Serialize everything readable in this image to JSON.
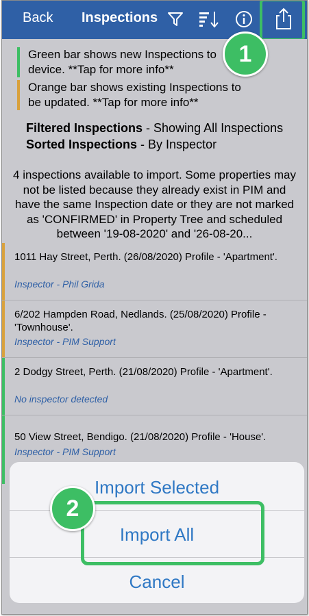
{
  "nav": {
    "back_label": "Back",
    "title": "Inspections",
    "icons": [
      "filter-icon",
      "sort-icon",
      "info-icon",
      "share-icon"
    ]
  },
  "legend": {
    "green_line1": "Green bar shows new Inspections to",
    "green_line2": "device. **Tap for more info**",
    "orange_line1": "Orange bar shows existing Inspections to",
    "orange_line2": "be updated. **Tap for more info**"
  },
  "status": {
    "filtered_label": "Filtered Inspections",
    "filtered_value": " - Showing All Inspections",
    "sorted_label": "Sorted Inspections",
    "sorted_value": " - By Inspector"
  },
  "notice": "4 inspections available to import. Some properties may not be listed because they already exist in PIM and have the same Inspection date or they are not marked as 'CONFIRMED' in Property Tree and scheduled between '19-08-2020' and '26-08-20...",
  "inspections": [
    {
      "address": "1011 Hay Street, Perth. (26/08/2020) Profile - 'Apartment'.",
      "inspector": "Inspector - Phil Grida",
      "bar_color": "#d9a13c"
    },
    {
      "address": "6/202 Hampden Road, Nedlands. (25/08/2020) Profile - 'Townhouse'.",
      "inspector": "Inspector - PIM Support",
      "bar_color": "#d9a13c"
    },
    {
      "address": " 2 Dodgy Street, Perth. (21/08/2020) Profile - 'Apartment'.",
      "inspector": "No inspector detected",
      "bar_color": "#3dbe64"
    },
    {
      "address": "50 View Street, Bendigo. (21/08/2020) Profile - 'House'.",
      "inspector": "Inspector - PIM Support",
      "bar_color": "#3dbe64"
    }
  ],
  "action_sheet": {
    "import_selected": "Import Selected",
    "import_all": "Import All",
    "cancel": "Cancel"
  },
  "callouts": {
    "badge1": "1",
    "badge2": "2",
    "color": "#3dbe64"
  },
  "colors": {
    "nav_bg": "#2f60a6",
    "link": "#2f78c4",
    "green": "#3dbe64",
    "orange": "#d9a13c"
  }
}
